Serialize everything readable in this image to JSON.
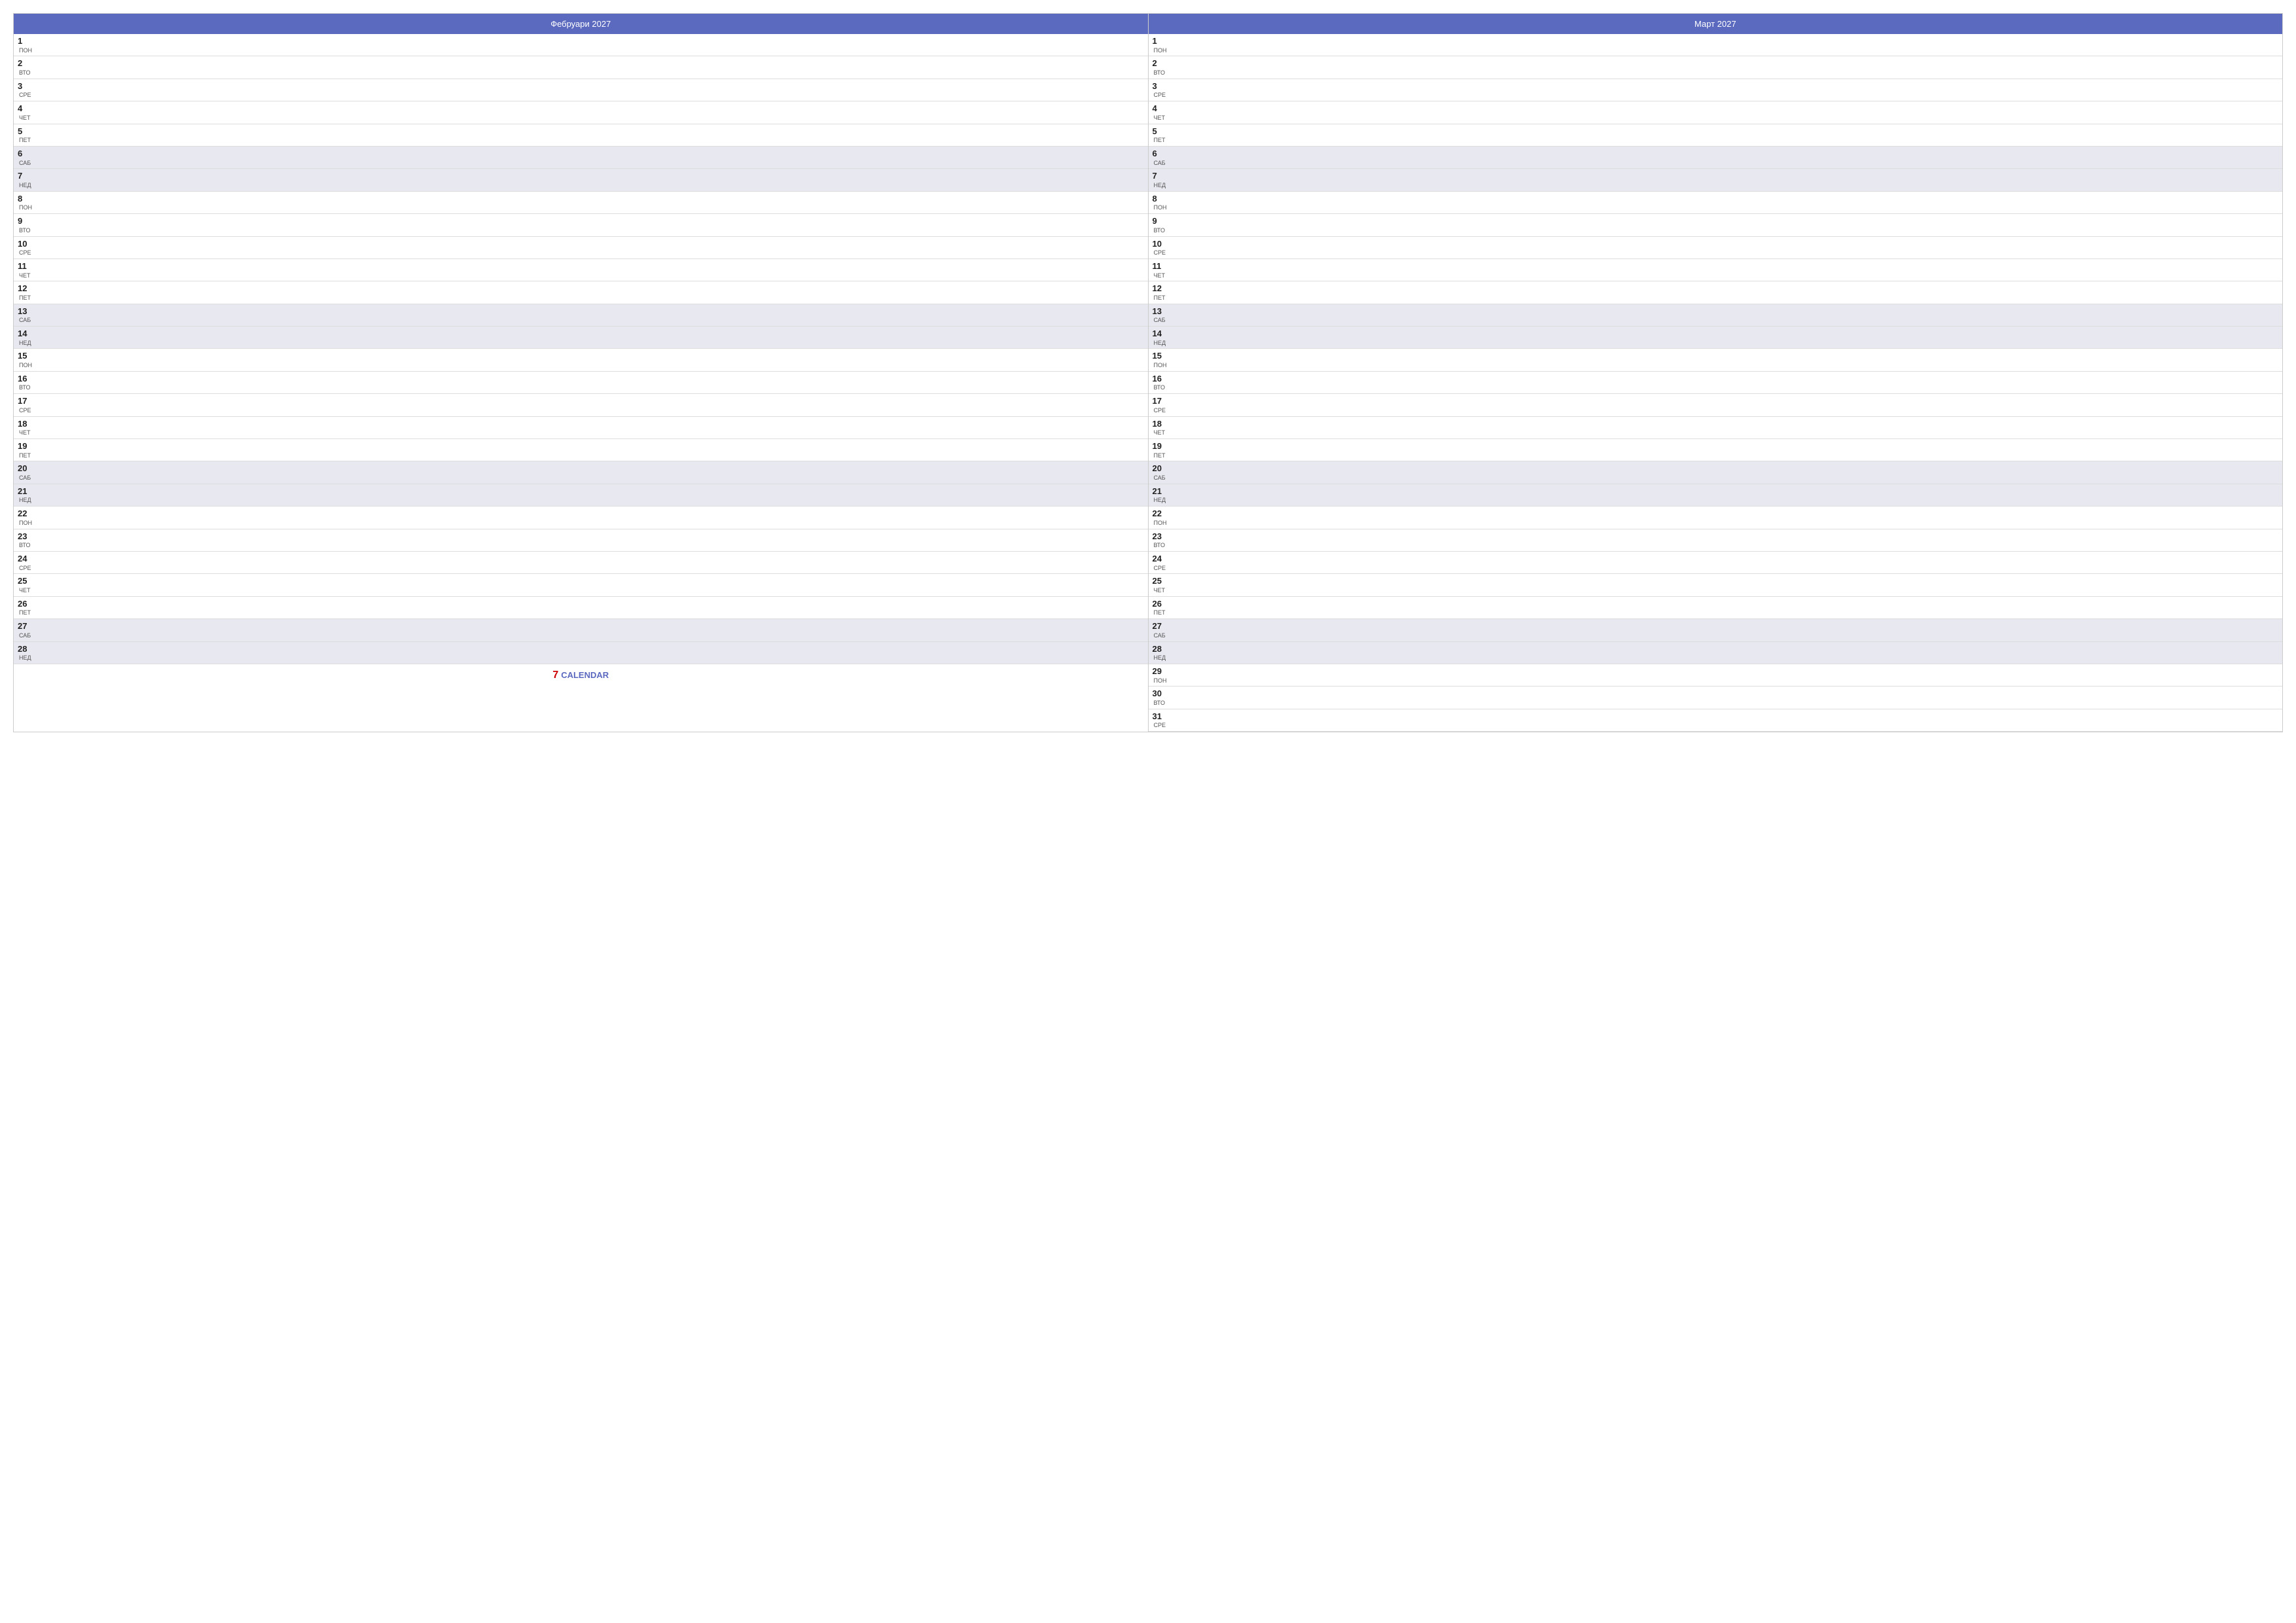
{
  "february": {
    "title": "Фебруари 2027",
    "days": [
      {
        "num": "1",
        "name": "ПОН",
        "weekend": false
      },
      {
        "num": "2",
        "name": "ВТО",
        "weekend": false
      },
      {
        "num": "3",
        "name": "СРЕ",
        "weekend": false
      },
      {
        "num": "4",
        "name": "ЧЕТ",
        "weekend": false
      },
      {
        "num": "5",
        "name": "ПЕТ",
        "weekend": false
      },
      {
        "num": "6",
        "name": "САБ",
        "weekend": true
      },
      {
        "num": "7",
        "name": "НЕД",
        "weekend": true
      },
      {
        "num": "8",
        "name": "ПОН",
        "weekend": false
      },
      {
        "num": "9",
        "name": "ВТО",
        "weekend": false
      },
      {
        "num": "10",
        "name": "СРЕ",
        "weekend": false
      },
      {
        "num": "11",
        "name": "ЧЕТ",
        "weekend": false
      },
      {
        "num": "12",
        "name": "ПЕТ",
        "weekend": false
      },
      {
        "num": "13",
        "name": "САБ",
        "weekend": true
      },
      {
        "num": "14",
        "name": "НЕД",
        "weekend": true
      },
      {
        "num": "15",
        "name": "ПОН",
        "weekend": false
      },
      {
        "num": "16",
        "name": "ВТО",
        "weekend": false
      },
      {
        "num": "17",
        "name": "СРЕ",
        "weekend": false
      },
      {
        "num": "18",
        "name": "ЧЕТ",
        "weekend": false
      },
      {
        "num": "19",
        "name": "ПЕТ",
        "weekend": false
      },
      {
        "num": "20",
        "name": "САБ",
        "weekend": true
      },
      {
        "num": "21",
        "name": "НЕД",
        "weekend": true
      },
      {
        "num": "22",
        "name": "ПОН",
        "weekend": false
      },
      {
        "num": "23",
        "name": "ВТО",
        "weekend": false
      },
      {
        "num": "24",
        "name": "СРЕ",
        "weekend": false
      },
      {
        "num": "25",
        "name": "ЧЕТ",
        "weekend": false
      },
      {
        "num": "26",
        "name": "ПЕТ",
        "weekend": false
      },
      {
        "num": "27",
        "name": "САБ",
        "weekend": true
      },
      {
        "num": "28",
        "name": "НЕД",
        "weekend": true
      }
    ]
  },
  "march": {
    "title": "Март 2027",
    "days": [
      {
        "num": "1",
        "name": "ПОН",
        "weekend": false
      },
      {
        "num": "2",
        "name": "ВТО",
        "weekend": false
      },
      {
        "num": "3",
        "name": "СРЕ",
        "weekend": false
      },
      {
        "num": "4",
        "name": "ЧЕТ",
        "weekend": false
      },
      {
        "num": "5",
        "name": "ПЕТ",
        "weekend": false
      },
      {
        "num": "6",
        "name": "САБ",
        "weekend": true
      },
      {
        "num": "7",
        "name": "НЕД",
        "weekend": true
      },
      {
        "num": "8",
        "name": "ПОН",
        "weekend": false
      },
      {
        "num": "9",
        "name": "ВТО",
        "weekend": false
      },
      {
        "num": "10",
        "name": "СРЕ",
        "weekend": false
      },
      {
        "num": "11",
        "name": "ЧЕТ",
        "weekend": false
      },
      {
        "num": "12",
        "name": "ПЕТ",
        "weekend": false
      },
      {
        "num": "13",
        "name": "САБ",
        "weekend": true
      },
      {
        "num": "14",
        "name": "НЕД",
        "weekend": true
      },
      {
        "num": "15",
        "name": "ПОН",
        "weekend": false
      },
      {
        "num": "16",
        "name": "ВТО",
        "weekend": false
      },
      {
        "num": "17",
        "name": "СРЕ",
        "weekend": false
      },
      {
        "num": "18",
        "name": "ЧЕТ",
        "weekend": false
      },
      {
        "num": "19",
        "name": "ПЕТ",
        "weekend": false
      },
      {
        "num": "20",
        "name": "САБ",
        "weekend": true
      },
      {
        "num": "21",
        "name": "НЕД",
        "weekend": true
      },
      {
        "num": "22",
        "name": "ПОН",
        "weekend": false
      },
      {
        "num": "23",
        "name": "ВТО",
        "weekend": false
      },
      {
        "num": "24",
        "name": "СРЕ",
        "weekend": false
      },
      {
        "num": "25",
        "name": "ЧЕТ",
        "weekend": false
      },
      {
        "num": "26",
        "name": "ПЕТ",
        "weekend": false
      },
      {
        "num": "27",
        "name": "САБ",
        "weekend": true
      },
      {
        "num": "28",
        "name": "НЕД",
        "weekend": true
      },
      {
        "num": "29",
        "name": "ПОН",
        "weekend": false
      },
      {
        "num": "30",
        "name": "ВТО",
        "weekend": false
      },
      {
        "num": "31",
        "name": "СРЕ",
        "weekend": false
      }
    ]
  },
  "footer": {
    "icon": "7",
    "label": "CALENDAR"
  }
}
